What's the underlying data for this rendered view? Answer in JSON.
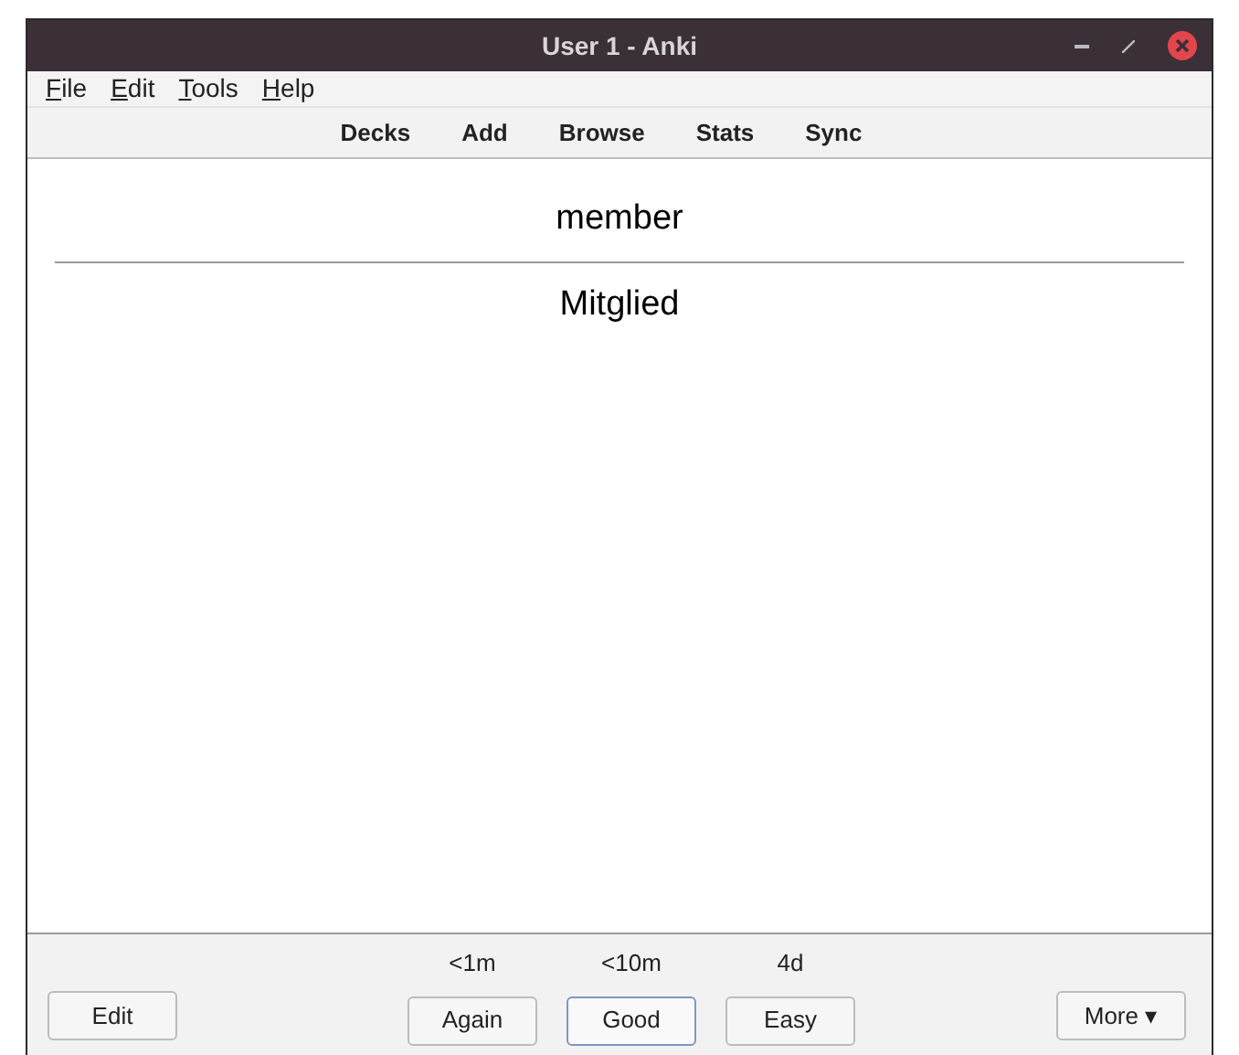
{
  "window": {
    "title": "User 1 - Anki"
  },
  "menu": [
    {
      "label": "File"
    },
    {
      "label": "Edit"
    },
    {
      "label": "Tools"
    },
    {
      "label": "Help"
    }
  ],
  "toolbar": [
    {
      "label": "Decks"
    },
    {
      "label": "Add"
    },
    {
      "label": "Browse"
    },
    {
      "label": "Stats"
    },
    {
      "label": "Sync"
    }
  ],
  "card": {
    "front": "member",
    "back": "Mitglied"
  },
  "bottom": {
    "edit": "Edit",
    "answers": [
      {
        "interval": "<1m",
        "label": "Again",
        "focused": false
      },
      {
        "interval": "<10m",
        "label": "Good",
        "focused": true
      },
      {
        "interval": "4d",
        "label": "Easy",
        "focused": false
      }
    ],
    "more": "More ▾"
  }
}
